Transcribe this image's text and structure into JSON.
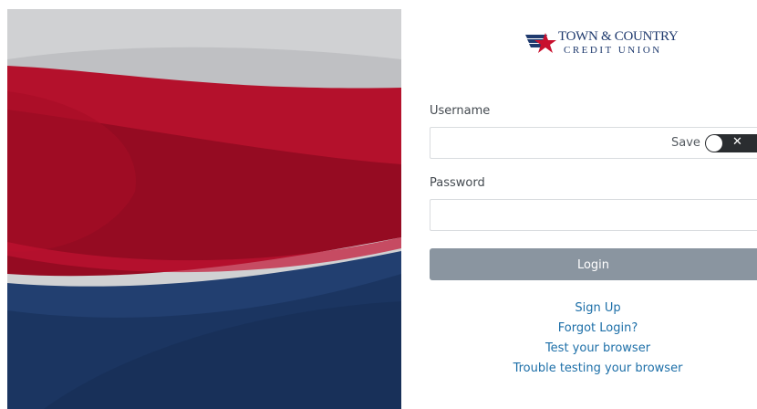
{
  "logo": {
    "line1": "TOWN & COUNTRY",
    "line2": "CREDIT UNION",
    "colors": {
      "red": "#c8102e",
      "navy": "#1f3a6e"
    }
  },
  "form": {
    "username_label": "Username",
    "username_value": "",
    "save_label": "Save",
    "save_toggle_state": "off",
    "password_label": "Password",
    "password_value": "",
    "login_label": "Login"
  },
  "links": [
    "Sign Up",
    "Forgot Login?",
    "Test your browser",
    "Trouble testing your browser"
  ],
  "colors": {
    "hero_red": "#a60d26",
    "hero_blue": "#1d3966",
    "hero_gray": "#c9cacc",
    "button": "#8a95a0",
    "link": "#1d6fa8"
  }
}
